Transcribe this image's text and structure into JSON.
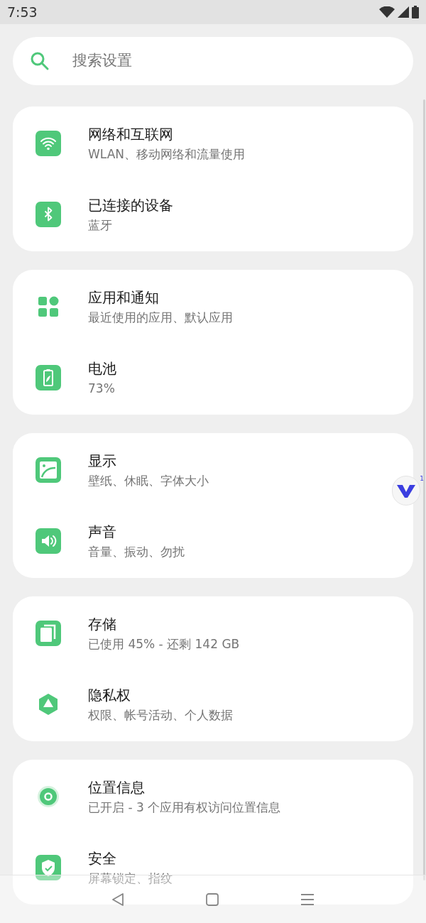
{
  "status_bar": {
    "time": "7:53"
  },
  "search": {
    "placeholder": "搜索设置"
  },
  "groups": [
    {
      "items": [
        {
          "kind": "wifi",
          "title": "网络和互联网",
          "subtitle": "WLAN、移动网络和流量使用"
        },
        {
          "kind": "bluetooth",
          "title": "已连接的设备",
          "subtitle": "蓝牙"
        }
      ]
    },
    {
      "items": [
        {
          "kind": "apps",
          "title": "应用和通知",
          "subtitle": "最近使用的应用、默认应用"
        },
        {
          "kind": "battery",
          "title": "电池",
          "subtitle": "73%"
        }
      ]
    },
    {
      "items": [
        {
          "kind": "display",
          "title": "显示",
          "subtitle": "壁纸、休眠、字体大小"
        },
        {
          "kind": "sound",
          "title": "声音",
          "subtitle": "音量、振动、勿扰"
        }
      ]
    },
    {
      "items": [
        {
          "kind": "storage",
          "title": "存储",
          "subtitle": "已使用 45% - 还剩 142 GB"
        },
        {
          "kind": "privacy",
          "title": "隐私权",
          "subtitle": "权限、帐号活动、个人数据"
        }
      ]
    },
    {
      "items": [
        {
          "kind": "location",
          "title": "位置信息",
          "subtitle": "已开启 - 3 个应用有权访问位置信息"
        },
        {
          "kind": "security",
          "title": "安全",
          "subtitle": "屏幕锁定、指纹"
        }
      ]
    }
  ],
  "floating_button": {
    "badge": "1"
  }
}
